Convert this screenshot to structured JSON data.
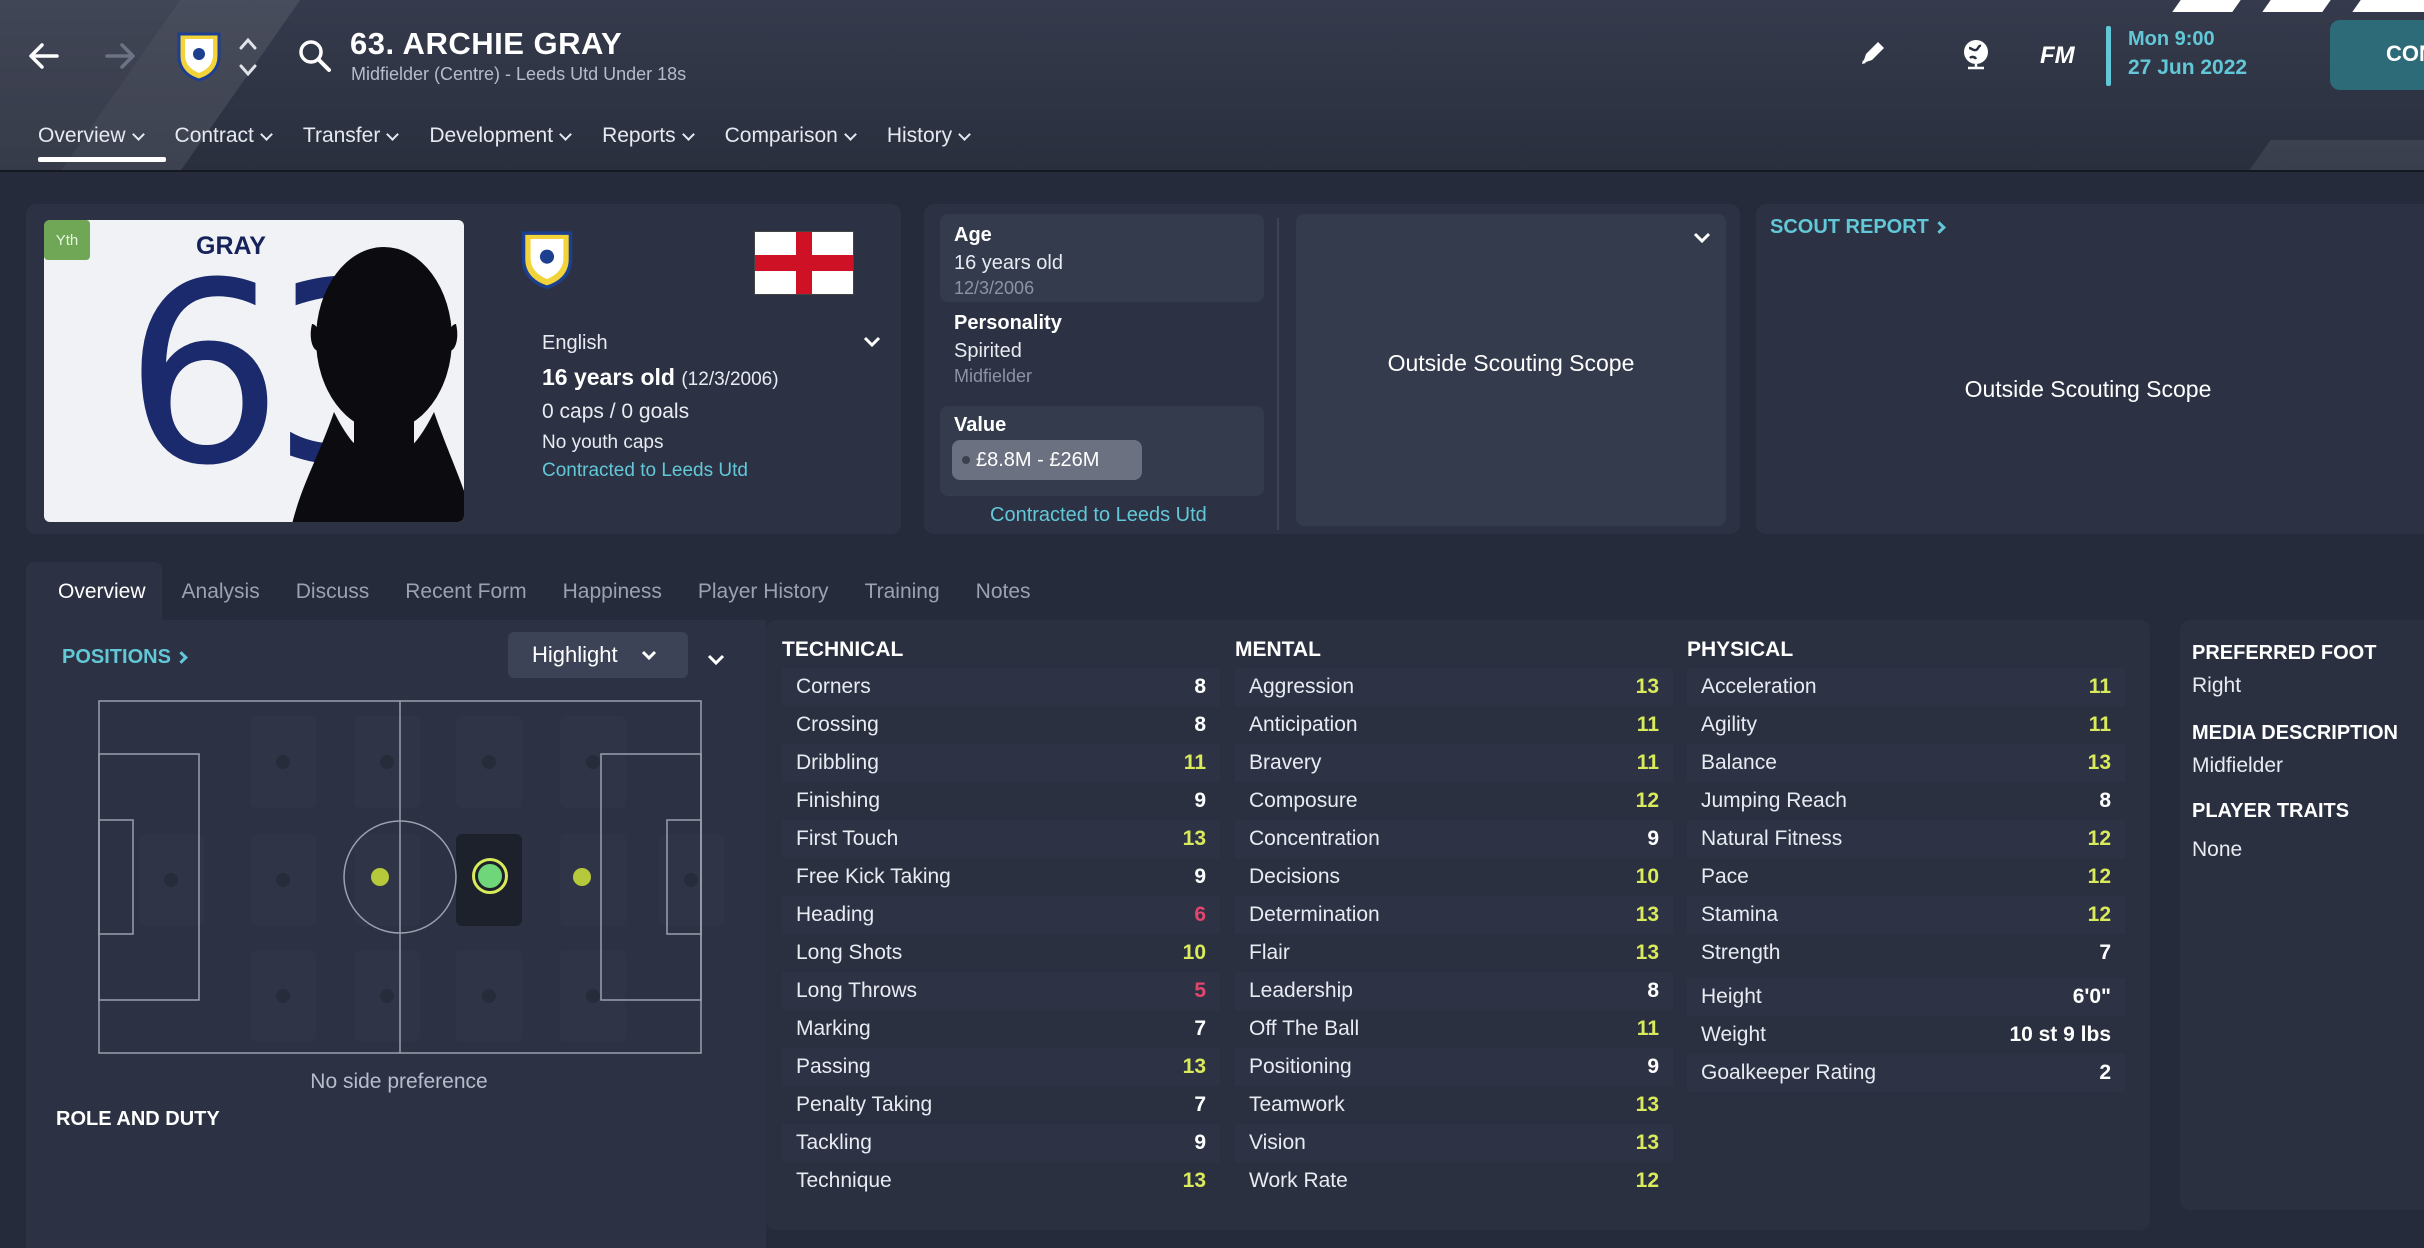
{
  "header": {
    "player_title": "63. ARCHIE GRAY",
    "player_subtitle": "Midfielder (Centre) - Leeds Utd Under 18s",
    "game_logo": "FM",
    "date_time": "Mon 9:00",
    "date": "27 Jun 2022",
    "continue_label": "CONTINUE"
  },
  "menu": [
    {
      "label": "Overview"
    },
    {
      "label": "Contract"
    },
    {
      "label": "Transfer"
    },
    {
      "label": "Development"
    },
    {
      "label": "Reports"
    },
    {
      "label": "Comparison"
    },
    {
      "label": "History"
    }
  ],
  "card": {
    "badge": "Yth",
    "shirt_name": "GRAY",
    "shirt_number": "63"
  },
  "profile": {
    "nationality": "English",
    "age_text": "16 years old",
    "dob_paren": "(12/3/2006)",
    "caps": "0 caps / 0 goals",
    "youth_caps": "No youth caps",
    "contract": "Contracted to Leeds Utd"
  },
  "info": {
    "age_label": "Age",
    "age_value": "16 years old",
    "age_dob": "12/3/2006",
    "personality_label": "Personality",
    "personality_value": "Spirited",
    "personality_role": "Midfielder",
    "value_label": "Value",
    "value_range": "£8.8M - £26M",
    "contract_link": "Contracted to Leeds Utd"
  },
  "scouting": {
    "scope_text": "Outside Scouting Scope",
    "report_title": "SCOUT REPORT",
    "report_text": "Outside Scouting Scope"
  },
  "subtabs": [
    "Overview",
    "Analysis",
    "Discuss",
    "Recent Form",
    "Happiness",
    "Player History",
    "Training",
    "Notes"
  ],
  "positions": {
    "title": "POSITIONS",
    "highlight_label": "Highlight",
    "side_pref": "No side preference",
    "role_title": "ROLE AND DUTY"
  },
  "attributes": {
    "technical_title": "TECHNICAL",
    "mental_title": "MENTAL",
    "physical_title": "PHYSICAL",
    "technical": [
      {
        "name": "Corners",
        "value": "8"
      },
      {
        "name": "Crossing",
        "value": "8"
      },
      {
        "name": "Dribbling",
        "value": "11"
      },
      {
        "name": "Finishing",
        "value": "9"
      },
      {
        "name": "First Touch",
        "value": "13"
      },
      {
        "name": "Free Kick Taking",
        "value": "9"
      },
      {
        "name": "Heading",
        "value": "6"
      },
      {
        "name": "Long Shots",
        "value": "10"
      },
      {
        "name": "Long Throws",
        "value": "5"
      },
      {
        "name": "Marking",
        "value": "7"
      },
      {
        "name": "Passing",
        "value": "13"
      },
      {
        "name": "Penalty Taking",
        "value": "7"
      },
      {
        "name": "Tackling",
        "value": "9"
      },
      {
        "name": "Technique",
        "value": "13"
      }
    ],
    "mental": [
      {
        "name": "Aggression",
        "value": "13"
      },
      {
        "name": "Anticipation",
        "value": "11"
      },
      {
        "name": "Bravery",
        "value": "11"
      },
      {
        "name": "Composure",
        "value": "12"
      },
      {
        "name": "Concentration",
        "value": "9"
      },
      {
        "name": "Decisions",
        "value": "10"
      },
      {
        "name": "Determination",
        "value": "13"
      },
      {
        "name": "Flair",
        "value": "13"
      },
      {
        "name": "Leadership",
        "value": "8"
      },
      {
        "name": "Off The Ball",
        "value": "11"
      },
      {
        "name": "Positioning",
        "value": "9"
      },
      {
        "name": "Teamwork",
        "value": "13"
      },
      {
        "name": "Vision",
        "value": "13"
      },
      {
        "name": "Work Rate",
        "value": "12"
      }
    ],
    "physical": [
      {
        "name": "Acceleration",
        "value": "11"
      },
      {
        "name": "Agility",
        "value": "11"
      },
      {
        "name": "Balance",
        "value": "13"
      },
      {
        "name": "Jumping Reach",
        "value": "8"
      },
      {
        "name": "Natural Fitness",
        "value": "12"
      },
      {
        "name": "Pace",
        "value": "12"
      },
      {
        "name": "Stamina",
        "value": "12"
      },
      {
        "name": "Strength",
        "value": "7"
      }
    ],
    "physical_extra": [
      {
        "name": "Height",
        "value": "6'0\""
      },
      {
        "name": "Weight",
        "value": "10 st 9 lbs"
      },
      {
        "name": "Goalkeeper Rating",
        "value": "2"
      }
    ]
  },
  "side": {
    "foot_label": "PREFERRED FOOT",
    "foot_value": "Right",
    "media_label": "MEDIA DESCRIPTION",
    "media_value": "Midfielder",
    "traits_label": "PLAYER TRAITS",
    "traits_value": "None"
  },
  "colors": {
    "accent": "#62c8d8",
    "high": "#d9ea5b",
    "low": "#e2456d",
    "continue_bg": "#2e6b78"
  }
}
